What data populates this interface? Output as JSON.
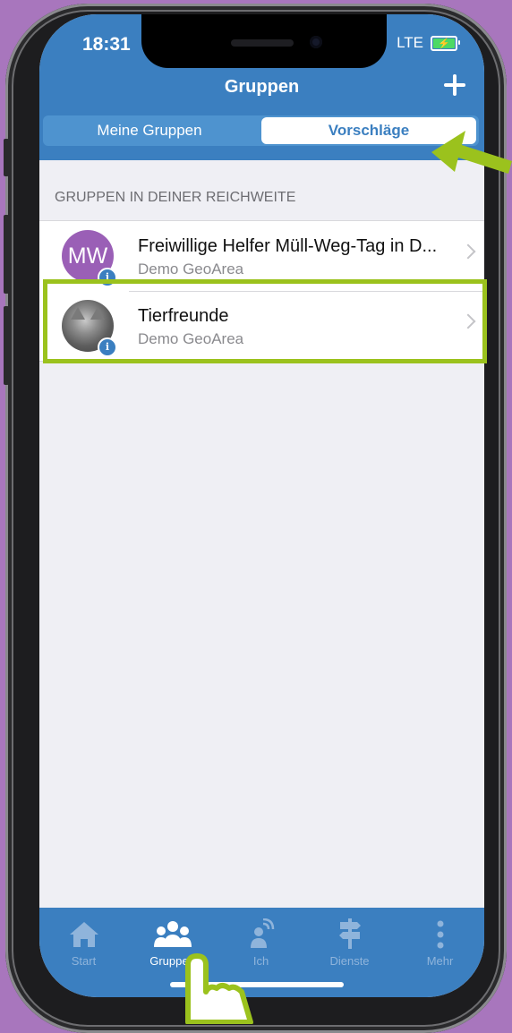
{
  "status": {
    "time": "18:31",
    "network": "LTE"
  },
  "nav": {
    "title": "Gruppen"
  },
  "segments": {
    "left": "Meine Gruppen",
    "right": "Vorschläge"
  },
  "section": {
    "header": "GRUPPEN IN DEINER REICHWEITE"
  },
  "groups": [
    {
      "initials": "MW",
      "title": "Freiwillige Helfer Müll-Weg-Tag in D...",
      "subtitle": "Demo GeoArea",
      "info": "i"
    },
    {
      "title": "Tierfreunde",
      "subtitle": "Demo GeoArea",
      "info": "i"
    }
  ],
  "tabs": [
    {
      "label": "Start",
      "icon": "home-icon"
    },
    {
      "label": "Gruppen",
      "icon": "people-icon"
    },
    {
      "label": "Ich",
      "icon": "person-broadcast-icon"
    },
    {
      "label": "Dienste",
      "icon": "signpost-icon"
    },
    {
      "label": "Mehr",
      "icon": "more-vertical-icon"
    }
  ],
  "colors": {
    "brand": "#3b7fc0",
    "highlight": "#9bc21d",
    "background": "#a876bd",
    "avatar": "#9a5fb6"
  }
}
